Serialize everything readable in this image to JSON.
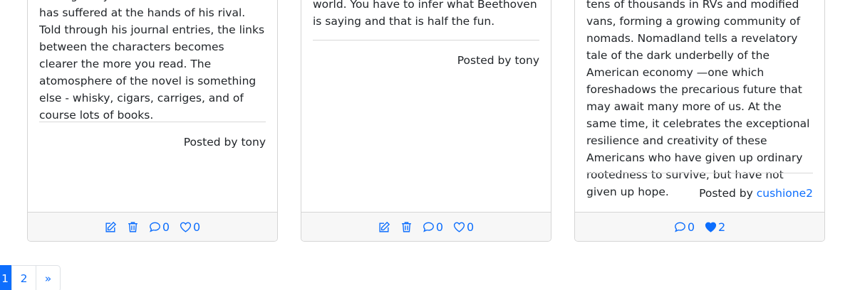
{
  "posts": [
    {
      "text": "revenge. Glyver reveals the torment he has suffered at the hands of his rival. Told through his journal entries, the links between the characters becomes clearer the more you read. The atomosphere of the novel is something else - whisky, cigars, carriges, and of course lots of books.",
      "posted_prefix": "Posted by ",
      "author": "tony",
      "author_is_link": false,
      "actions": {
        "show_edit": true,
        "show_delete": true,
        "comments": "0",
        "likes": "0",
        "liked": false
      }
    },
    {
      "text": "world. You have to infer what Beethoven is saying and that is half the fun.",
      "posted_prefix": "Posted by ",
      "author": "tony",
      "author_is_link": false,
      "actions": {
        "show_edit": true,
        "show_delete": true,
        "comments": "0",
        "likes": "0",
        "liked": false
      }
    },
    {
      "text": "tens of thousands in RVs and modified vans, forming a growing community of nomads. Nomadland tells a revelatory tale of the dark underbelly of the American economy —one which foreshadows the precarious future that may await many more of us. At the same time, it celebrates the exceptional resilience and creativity of these Americans who have given up ordinary rootedness to survive, but have not given up hope.",
      "posted_prefix": "Posted by ",
      "author": "cushione2",
      "author_is_link": true,
      "actions": {
        "show_edit": false,
        "show_delete": false,
        "comments": "0",
        "likes": "2",
        "liked": true
      }
    }
  ],
  "pagination": {
    "pages": [
      "1",
      "2"
    ],
    "current": "1",
    "next_label": "»"
  },
  "colors": {
    "accent": "#0d6efd",
    "footer_bg": "#f7f7f7",
    "border": "#d5d5d5"
  }
}
